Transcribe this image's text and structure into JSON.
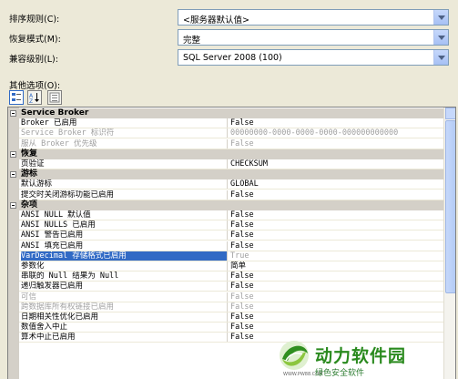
{
  "form": {
    "sort_rule": {
      "label": "排序规则(C):",
      "value": "<服务器默认值>"
    },
    "recovery_model": {
      "label": "恢复模式(M):",
      "value": "完整"
    },
    "compat_level": {
      "label": "兼容级别(L):",
      "value": "SQL Server 2008 (100)"
    },
    "other_options_label": "其他选项(O):"
  },
  "toolbar": {
    "categorized_icon": "categorized-icon",
    "alphabetical_icon": "alphabetical-icon",
    "property_pages_icon": "property-pages-icon"
  },
  "property_grid": {
    "rows": [
      {
        "type": "category",
        "name": "Service Broker"
      },
      {
        "type": "prop",
        "name": "Broker 已启用",
        "value": "False",
        "state": "normal"
      },
      {
        "type": "prop",
        "name": "Service Broker 标识符",
        "value": "00000000-0000-0000-0000-000000000000",
        "state": "disabled"
      },
      {
        "type": "prop",
        "name": "服从 Broker 优先级",
        "value": "False",
        "state": "disabled"
      },
      {
        "type": "category",
        "name": "恢复"
      },
      {
        "type": "prop",
        "name": "页验证",
        "value": "CHECKSUM",
        "state": "normal"
      },
      {
        "type": "category",
        "name": "游标"
      },
      {
        "type": "prop",
        "name": "默认游标",
        "value": "GLOBAL",
        "state": "normal"
      },
      {
        "type": "prop",
        "name": "提交时关闭游标功能已启用",
        "value": "False",
        "state": "normal"
      },
      {
        "type": "category",
        "name": "杂项"
      },
      {
        "type": "prop",
        "name": "ANSI NULL 默认值",
        "value": "False",
        "state": "normal"
      },
      {
        "type": "prop",
        "name": "ANSI NULLS 已启用",
        "value": "False",
        "state": "normal"
      },
      {
        "type": "prop",
        "name": "ANSI 警告已启用",
        "value": "False",
        "state": "normal"
      },
      {
        "type": "prop",
        "name": "ANSI 填充已启用",
        "value": "False",
        "state": "normal"
      },
      {
        "type": "prop",
        "name": "VarDecimal 存储格式已启用",
        "value": "True",
        "state": "selected"
      },
      {
        "type": "prop",
        "name": "参数化",
        "value": "简单",
        "state": "normal"
      },
      {
        "type": "prop",
        "name": "串联的 Null 结果为 Null",
        "value": "False",
        "state": "normal"
      },
      {
        "type": "prop",
        "name": "递归触发器已启用",
        "value": "False",
        "state": "normal"
      },
      {
        "type": "prop",
        "name": "可信",
        "value": "False",
        "state": "disabled"
      },
      {
        "type": "prop",
        "name": "跨数据库所有权链接已启用",
        "value": "False",
        "state": "disabled"
      },
      {
        "type": "prop",
        "name": "日期相关性优化已启用",
        "value": "False",
        "state": "normal"
      },
      {
        "type": "prop",
        "name": "数值舍入中止",
        "value": "False",
        "state": "normal"
      },
      {
        "type": "prop",
        "name": "算术中止已启用",
        "value": "False",
        "state": "normal"
      }
    ]
  },
  "watermark": {
    "title": "动力软件园",
    "subtitle": "绿色安全软件",
    "url": "WWW.PW88.COM"
  },
  "colors": {
    "window_bg": "#ece9d8",
    "selection": "#316ac5",
    "category_bg": "#d4d0c8",
    "disabled_text": "#a0a0a0",
    "watermark_green": "#2a8a1e"
  }
}
